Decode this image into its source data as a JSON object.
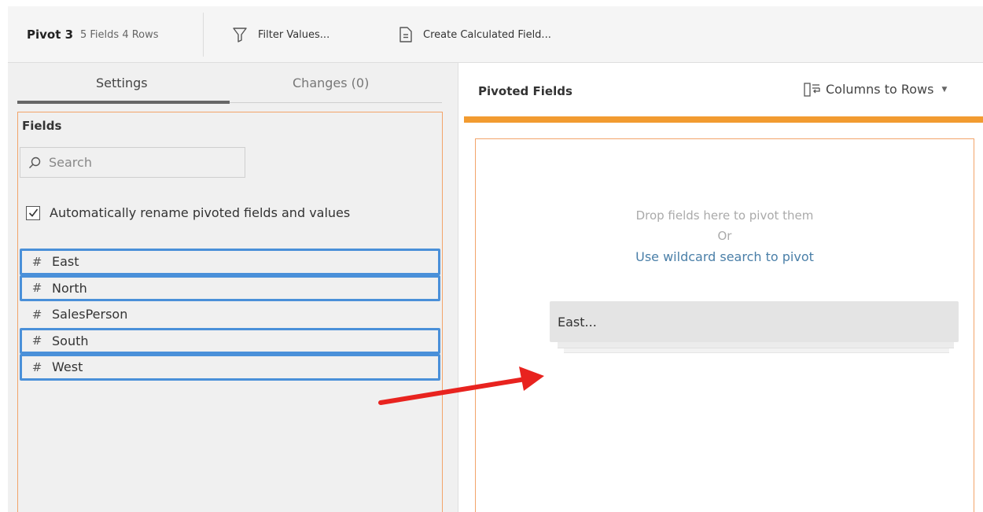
{
  "toolbar": {
    "title": "Pivot 3",
    "meta": "5 Fields  4 Rows",
    "filter_label": "Filter Values...",
    "calc_label": "Create Calculated Field..."
  },
  "left_panel": {
    "tabs": [
      {
        "label": "Settings"
      },
      {
        "label": "Changes (0)"
      }
    ],
    "fields_title": "Fields",
    "search_placeholder": "Search",
    "auto_rename_label": "Automatically rename pivoted fields and values",
    "auto_rename_checked": true,
    "fields": [
      {
        "label": "East",
        "type_icon": "hash-icon",
        "selected": true
      },
      {
        "label": "North",
        "type_icon": "hash-icon",
        "selected": true
      },
      {
        "label": "SalesPerson",
        "type_icon": "hash-icon",
        "selected": false
      },
      {
        "label": "South",
        "type_icon": "hash-icon",
        "selected": true
      },
      {
        "label": "West",
        "type_icon": "hash-icon",
        "selected": true
      }
    ]
  },
  "right_panel": {
    "title": "Pivoted Fields",
    "mode_label": "Columns to Rows",
    "drop_hint": "Drop fields here to pivot them",
    "or_label": "Or",
    "wildcard_link": "Use wildcard search to pivot",
    "drag_card_label": "East..."
  },
  "colors": {
    "accent_orange": "#f29b30",
    "selection_blue": "#4a90d9",
    "annotation_arrow": "#e8231f",
    "link_blue": "#4a7fa8"
  }
}
